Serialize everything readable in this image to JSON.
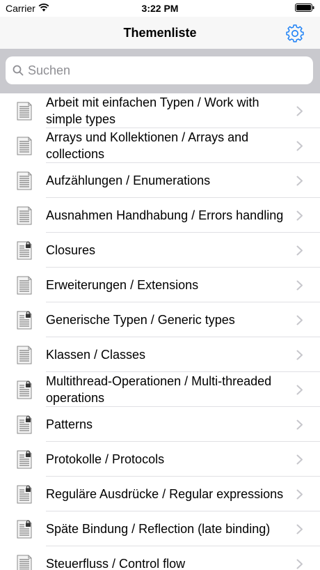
{
  "status": {
    "carrier": "Carrier",
    "time": "3:22 PM"
  },
  "nav": {
    "title": "Themenliste",
    "settings_icon": "gear-icon",
    "tint_color": "#1a7ff6"
  },
  "search": {
    "placeholder": "Suchen"
  },
  "topics": [
    {
      "label": "Arbeit mit einfachen Typen / Work with simple types",
      "locked": false
    },
    {
      "label": "Arrays und Kollektionen / Arrays and collections",
      "locked": false
    },
    {
      "label": "Aufzählungen / Enumerations",
      "locked": false
    },
    {
      "label": "Ausnahmen Handhabung / Errors handling",
      "locked": false
    },
    {
      "label": "Closures",
      "locked": true
    },
    {
      "label": "Erweiterungen / Extensions",
      "locked": false
    },
    {
      "label": "Generische Typen / Generic types",
      "locked": true
    },
    {
      "label": "Klassen / Classes",
      "locked": false
    },
    {
      "label": "Multithread-Operationen / Multi-threaded operations",
      "locked": true
    },
    {
      "label": "Patterns",
      "locked": true
    },
    {
      "label": "Protokolle / Protocols",
      "locked": true
    },
    {
      "label": "Reguläre Ausdrücke / Regular expressions",
      "locked": true
    },
    {
      "label": "Späte Bindung / Reflection (late binding)",
      "locked": true
    },
    {
      "label": "Steuerfluss / Control flow",
      "locked": false
    }
  ]
}
